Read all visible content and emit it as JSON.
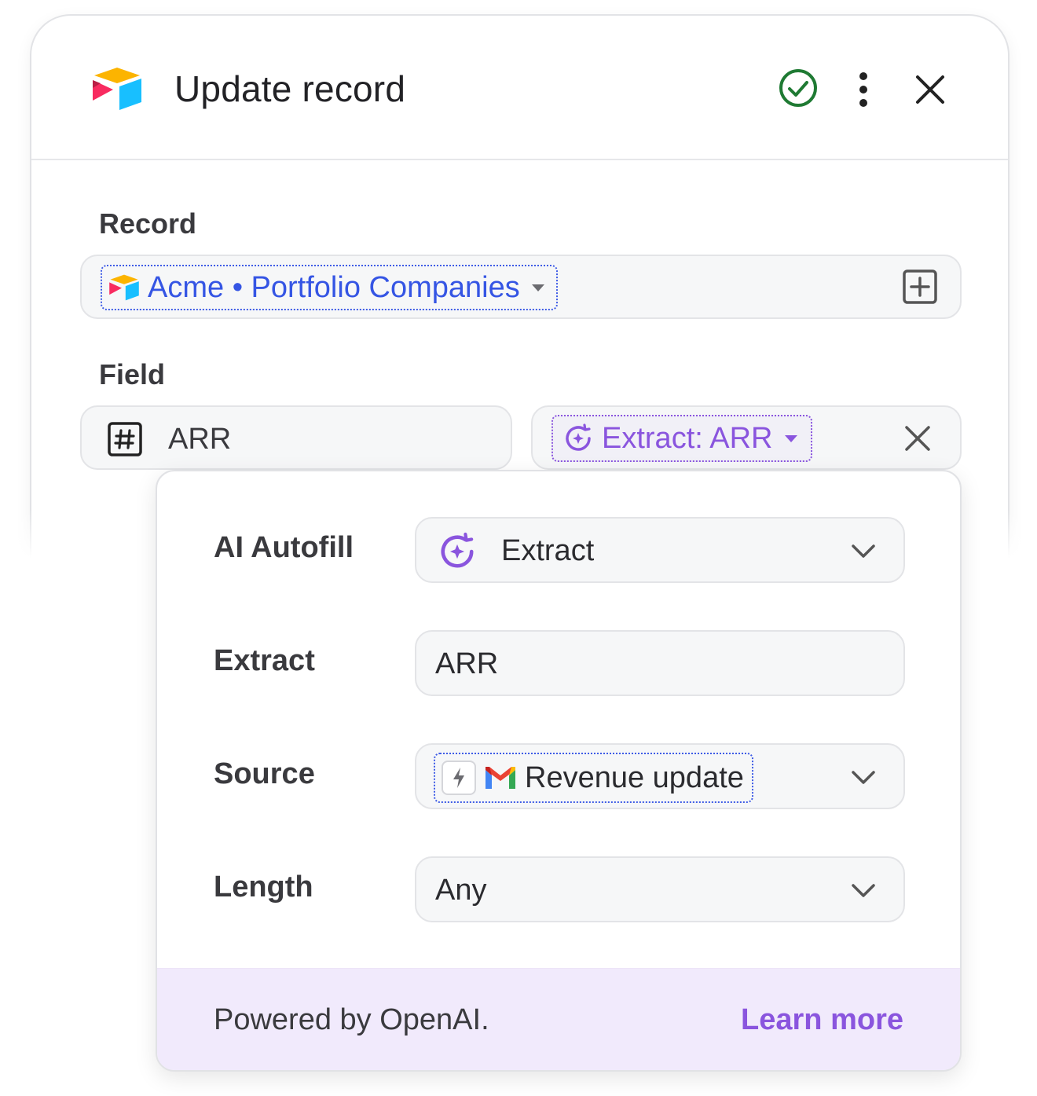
{
  "header": {
    "title": "Update record",
    "icons": [
      "airtable-logo",
      "check-circle-icon",
      "more-vertical-icon",
      "close-icon"
    ]
  },
  "record": {
    "label": "Record",
    "chip_text": "Acme • Portfolio Companies"
  },
  "field": {
    "label": "Field",
    "value": "ARR",
    "mapping_chip": "Extract: ARR"
  },
  "popover": {
    "rows": [
      {
        "label": "AI Autofill",
        "value": "Extract"
      },
      {
        "label": "Extract",
        "value": "ARR"
      },
      {
        "label": "Source",
        "value": "Revenue update"
      },
      {
        "label": "Length",
        "value": "Any"
      }
    ],
    "footer": {
      "powered": "Powered by OpenAI.",
      "learn_more": "Learn more"
    }
  },
  "colors": {
    "accent_purple": "#8a55de",
    "accent_blue": "#3555e4",
    "success_green": "#1f7a33",
    "footer_bg": "#f1eafc"
  }
}
